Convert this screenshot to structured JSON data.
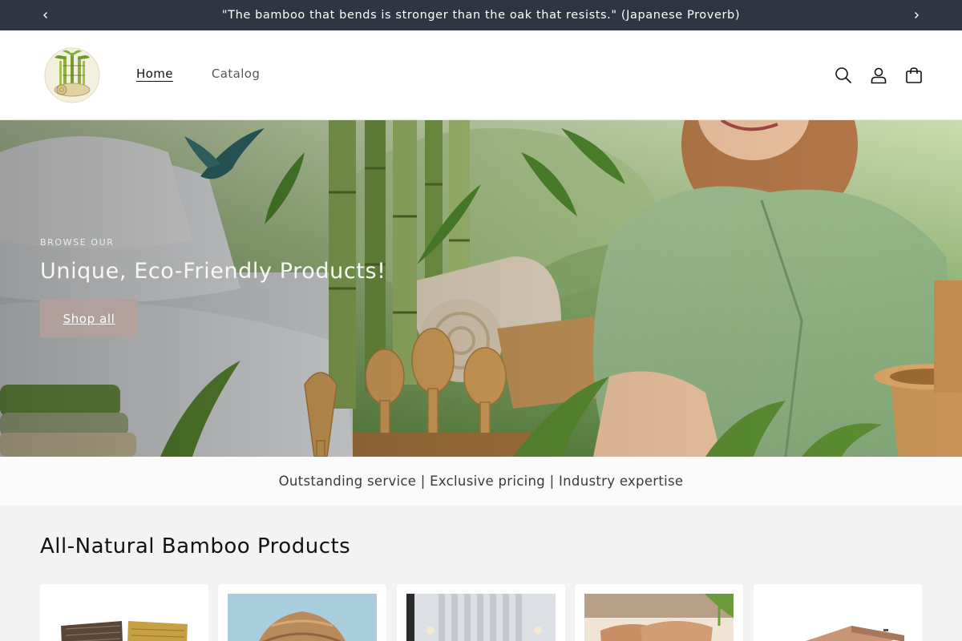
{
  "announcement": {
    "text": "\"The bamboo that bends is stronger than the oak that resists.\" (Japanese Proverb)",
    "prev_icon": "chevron-left-icon",
    "next_icon": "chevron-right-icon"
  },
  "header": {
    "logo_icon": "bamboo-logo-icon",
    "nav": [
      {
        "label": "Home",
        "active": true
      },
      {
        "label": "Catalog",
        "active": false
      }
    ],
    "icons": [
      "search-icon",
      "account-icon",
      "cart-icon"
    ]
  },
  "hero": {
    "eyebrow": "BROWSE OUR",
    "title": "Unique, Eco-Friendly Products!",
    "button_label": "Shop all"
  },
  "tagline": "Outstanding service | Exclusive pricing | Industry expertise",
  "products": {
    "title": "All-Natural Bamboo Products"
  },
  "colors": {
    "announcement_bg": "#2f3542",
    "button_bg": "#b2a09a",
    "section_bg": "#f3f3f3"
  }
}
